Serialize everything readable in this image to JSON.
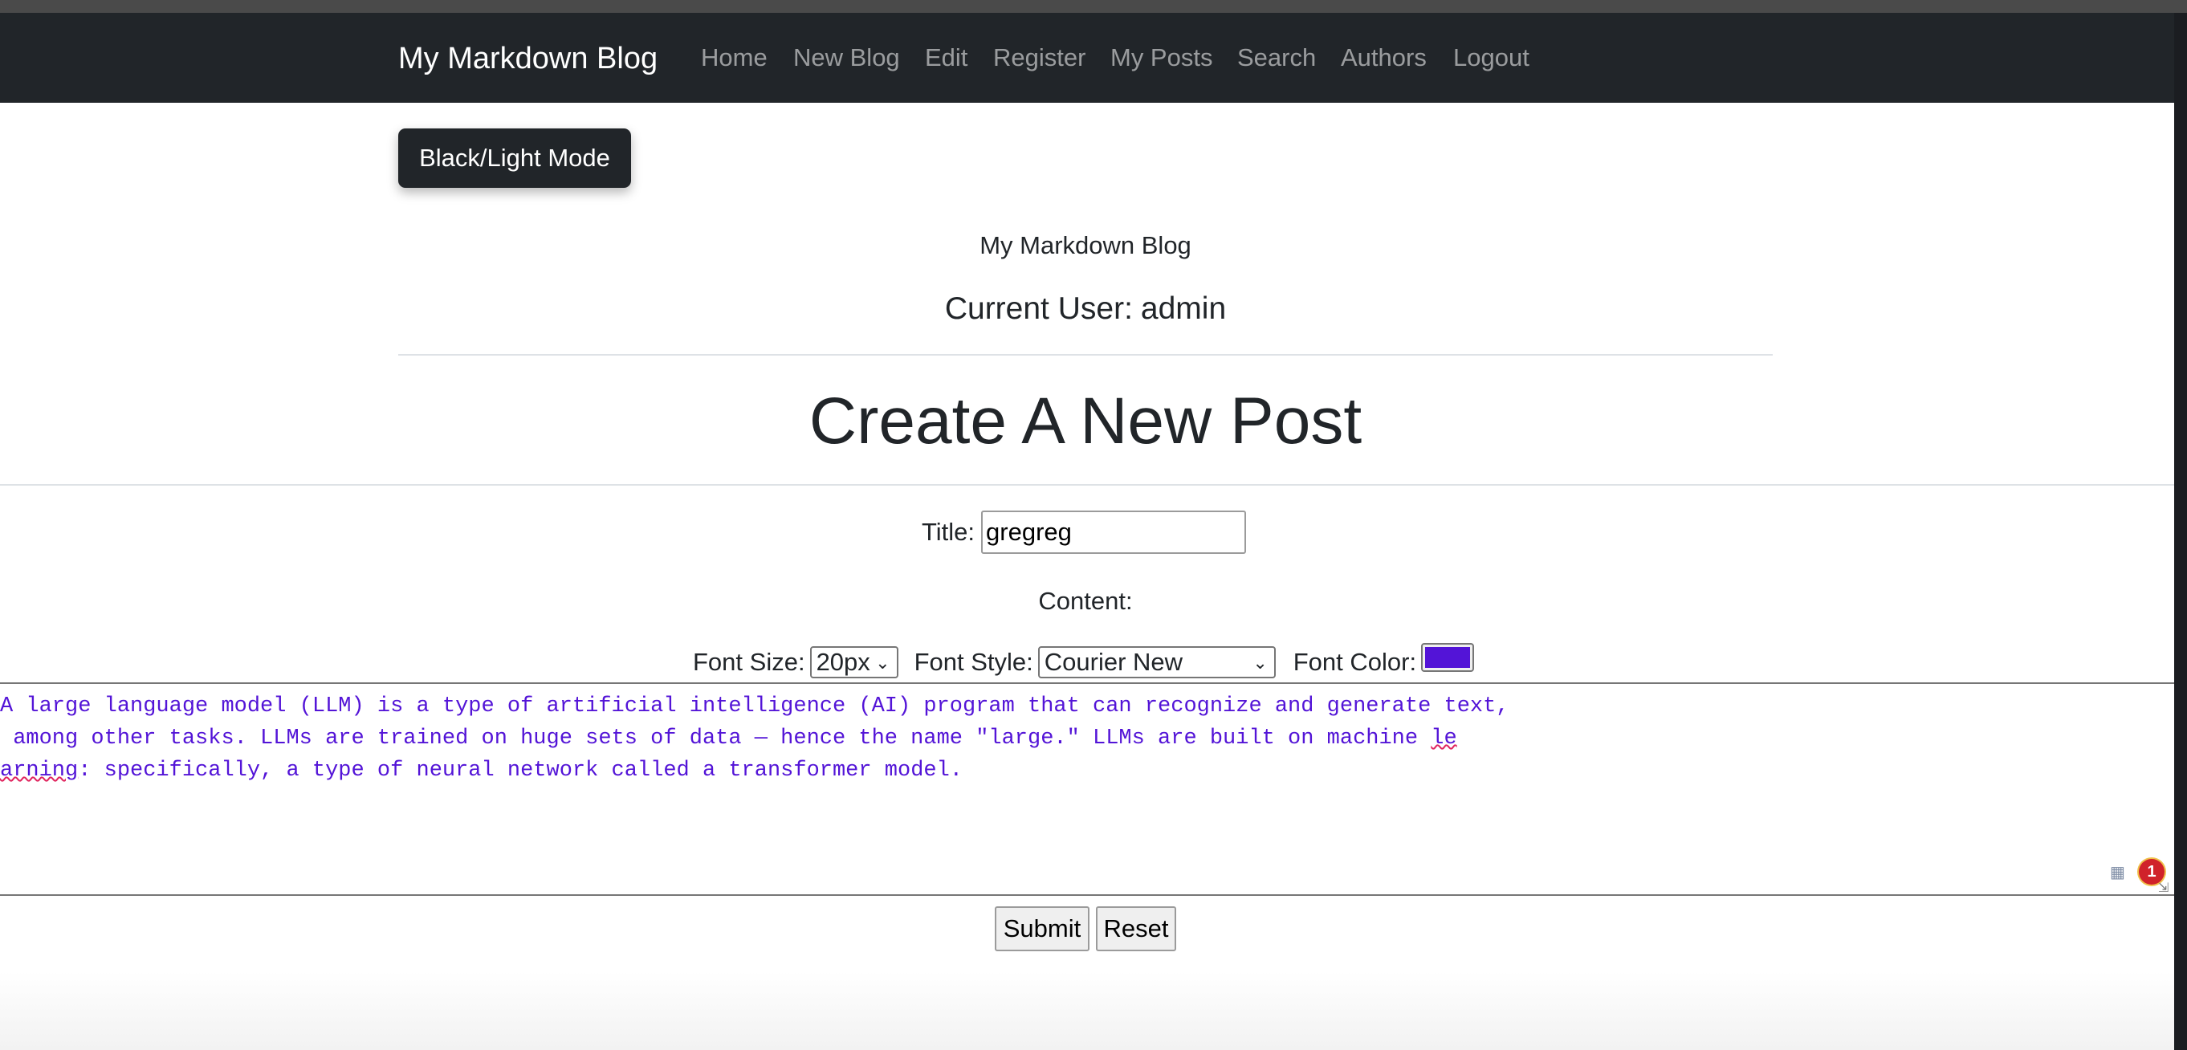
{
  "nav": {
    "brand": "My Markdown Blog",
    "items": [
      "Home",
      "New Blog",
      "Edit",
      "Register",
      "My Posts",
      "Search",
      "Authors",
      "Logout"
    ]
  },
  "mode_button": "Black/Light Mode",
  "site_title": "My Markdown Blog",
  "current_user": {
    "label": "Current User:",
    "name": "admin"
  },
  "page_heading": "Create A New Post",
  "form": {
    "title_label": "Title:",
    "title_value": "gregreg",
    "content_label": "Content:",
    "font_size_label": "Font Size:",
    "font_size_value": "20px",
    "font_style_label": "Font Style:",
    "font_style_value": "Courier New",
    "font_color_label": "Font Color:",
    "font_color_value": "#5314d7",
    "content_lines": [
      "A large language model (LLM) is a type of artificial intelligence (AI) program that can recognize and generate text,",
      " among other tasks. LLMs are trained on huge sets of data — hence the name \"large.\" LLMs are built on machine ",
      "arning",
      ": specifically, a type of neural network called a transformer model."
    ],
    "content_spell_tail": "le",
    "grammar_badge": "1",
    "submit_label": "Submit",
    "reset_label": "Reset"
  },
  "colors": {
    "navbar": "#212529",
    "content_text": "#5314d7"
  }
}
